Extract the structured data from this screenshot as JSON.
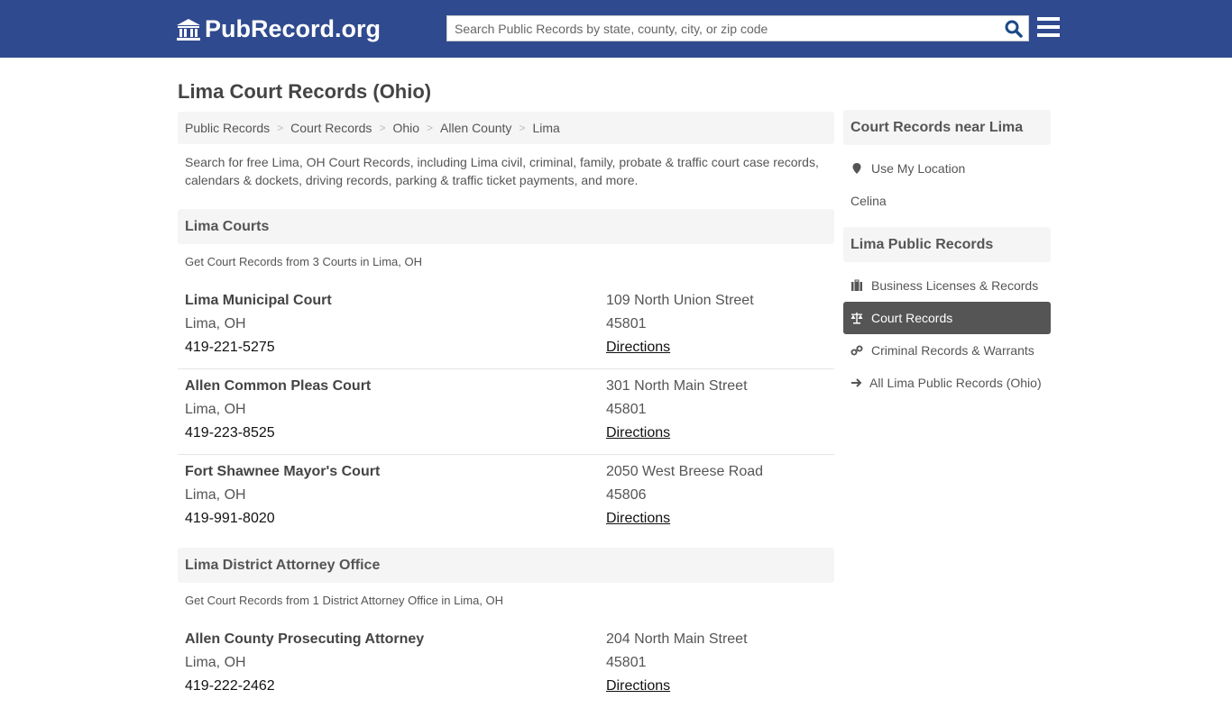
{
  "header": {
    "logo_text": "PubRecord.org",
    "search_placeholder": "Search Public Records by state, county, city, or zip code",
    "search_value": "",
    "colors": {
      "bar": "#2f4a8e",
      "search_icon": "#1b4a87"
    }
  },
  "page": {
    "title": "Lima Court Records (Ohio)",
    "breadcrumb": [
      "Public Records",
      "Court Records",
      "Ohio",
      "Allen County",
      "Lima"
    ],
    "intro": "Search for free Lima, OH Court Records, including Lima civil, criminal, family, probate & traffic court case records, calendars & dockets, driving records, parking & traffic ticket payments, and more."
  },
  "sections": [
    {
      "title": "Lima Courts",
      "subtitle": "Get Court Records from 3 Courts in Lima, OH",
      "entries": [
        {
          "name": "Lima Municipal Court",
          "city": "Lima, OH",
          "phone": "419-221-5275",
          "address": "109 North Union Street",
          "zip": "45801",
          "directions": "Directions"
        },
        {
          "name": "Allen Common Pleas Court",
          "city": "Lima, OH",
          "phone": "419-223-8525",
          "address": "301 North Main Street",
          "zip": "45801",
          "directions": "Directions"
        },
        {
          "name": "Fort Shawnee Mayor's Court",
          "city": "Lima, OH",
          "phone": "419-991-8020",
          "address": "2050 West Breese Road",
          "zip": "45806",
          "directions": "Directions"
        }
      ]
    },
    {
      "title": "Lima District Attorney Office",
      "subtitle": "Get Court Records from 1 District Attorney Office in Lima, OH",
      "entries": [
        {
          "name": "Allen County Prosecuting Attorney",
          "city": "Lima, OH",
          "phone": "419-222-2462",
          "address": "204 North Main Street",
          "zip": "45801",
          "directions": "Directions"
        }
      ]
    }
  ],
  "sidebar": {
    "near": {
      "title": "Court Records near Lima",
      "use_location": "Use My Location",
      "cities": [
        "Celina"
      ]
    },
    "public_records": {
      "title": "Lima Public Records",
      "items": [
        {
          "label": "Business Licenses & Records",
          "icon": "briefcase-icon",
          "active": false
        },
        {
          "label": "Court Records",
          "icon": "scale-icon",
          "active": true
        },
        {
          "label": "Criminal Records & Warrants",
          "icon": "link-icon",
          "active": false
        },
        {
          "label": "All Lima Public Records (Ohio)",
          "icon": "arrow-right-icon",
          "active": false
        }
      ]
    }
  }
}
